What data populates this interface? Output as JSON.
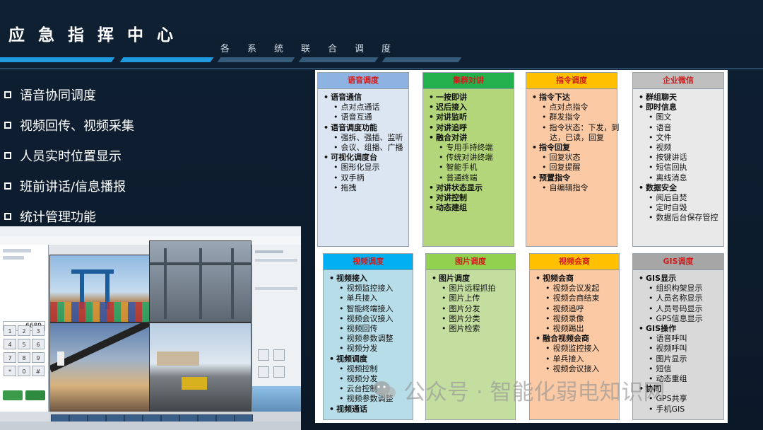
{
  "header": {
    "title": "应急指挥中心",
    "subtitle": "各系统联合调度"
  },
  "colors": {
    "background": "#0f2033",
    "accent_blue": "#1f9be0",
    "accent_dark": "#345b7a",
    "header_text": "#d11b1b"
  },
  "bullets": [
    "语音协同调度",
    "视频回传、视频采集",
    "人员实时位置显示",
    "班前讲话/信息播报",
    "统计管理功能"
  ],
  "screenshot": {
    "dial_value": "6689",
    "keys": [
      "1",
      "2",
      "3",
      "4",
      "5",
      "6",
      "7",
      "8",
      "9",
      "*",
      "0",
      "#"
    ]
  },
  "cards": [
    {
      "title": "语音调度",
      "head_color": "#8db3e2",
      "body_color": "#dce6f2",
      "items": [
        {
          "t": "语音通信",
          "lvl": 1
        },
        {
          "t": "点对点通话",
          "lvl": 2
        },
        {
          "t": "语音互通",
          "lvl": 2
        },
        {
          "t": "语音调度功能",
          "lvl": 1
        },
        {
          "t": "强拆、强插、监听",
          "lvl": 2
        },
        {
          "t": "会议、组播、广播",
          "lvl": 2
        },
        {
          "t": "可视化调度台",
          "lvl": 1
        },
        {
          "t": "图形化显示",
          "lvl": 2
        },
        {
          "t": "双手柄",
          "lvl": 2
        },
        {
          "t": "拖拽",
          "lvl": 2
        }
      ]
    },
    {
      "title": "集群对讲",
      "head_color": "#22b14c",
      "body_color": "#b4d67a",
      "items": [
        {
          "t": "一按即讲",
          "lvl": 1
        },
        {
          "t": "迟后接入",
          "lvl": 1
        },
        {
          "t": "对讲监听",
          "lvl": 1
        },
        {
          "t": "对讲追呼",
          "lvl": 1
        },
        {
          "t": "融合对讲",
          "lvl": 1
        },
        {
          "t": "专用手持终端",
          "lvl": 2
        },
        {
          "t": "传统对讲终端",
          "lvl": 2
        },
        {
          "t": "智能手机",
          "lvl": 2
        },
        {
          "t": "普通终端",
          "lvl": 2
        },
        {
          "t": "对讲状态显示",
          "lvl": 1
        },
        {
          "t": "对讲控制",
          "lvl": 1
        },
        {
          "t": "动态建组",
          "lvl": 1
        }
      ]
    },
    {
      "title": "指令调度",
      "head_color": "#ffc000",
      "body_color": "#fbc9a4",
      "items": [
        {
          "t": "指令下达",
          "lvl": 1
        },
        {
          "t": "点对点指令",
          "lvl": 2
        },
        {
          "t": "群发指令",
          "lvl": 2
        },
        {
          "t": "指令状态：下发，到",
          "lvl": 2
        },
        {
          "t": "达，已读，回复",
          "lvl": 3
        },
        {
          "t": "指令回复",
          "lvl": 1
        },
        {
          "t": "回复状态",
          "lvl": 2
        },
        {
          "t": "回复提醒",
          "lvl": 2
        },
        {
          "t": "预置指令",
          "lvl": 1
        },
        {
          "t": "自编辑指令",
          "lvl": 2
        }
      ]
    },
    {
      "title": "企业微信",
      "head_color": "#bfbfbf",
      "body_color": "#e9e9e9",
      "items": [
        {
          "t": "群组聊天",
          "lvl": 1
        },
        {
          "t": "即时信息",
          "lvl": 1
        },
        {
          "t": "图文",
          "lvl": 2
        },
        {
          "t": "语音",
          "lvl": 2
        },
        {
          "t": "文件",
          "lvl": 2
        },
        {
          "t": "视频",
          "lvl": 2
        },
        {
          "t": "按键讲话",
          "lvl": 2
        },
        {
          "t": "短信回执",
          "lvl": 2
        },
        {
          "t": "离线消息",
          "lvl": 2
        },
        {
          "t": "数据安全",
          "lvl": 1
        },
        {
          "t": "阅后自焚",
          "lvl": 2
        },
        {
          "t": "定时自毁",
          "lvl": 2
        },
        {
          "t": "数据后台保存管控",
          "lvl": 2
        }
      ]
    },
    {
      "title": "视频调度",
      "head_color": "#00b0f0",
      "body_color": "#b7dde8",
      "items": [
        {
          "t": "视频接入",
          "lvl": 1
        },
        {
          "t": "视频监控接入",
          "lvl": 2
        },
        {
          "t": "单兵接入",
          "lvl": 2
        },
        {
          "t": "智能终端接入",
          "lvl": 2
        },
        {
          "t": "视频会议接入",
          "lvl": 2
        },
        {
          "t": "视频回传",
          "lvl": 2
        },
        {
          "t": "视频参数调整",
          "lvl": 2
        },
        {
          "t": "视频分发",
          "lvl": 2
        },
        {
          "t": "视频调度",
          "lvl": 1
        },
        {
          "t": "视频控制",
          "lvl": 2
        },
        {
          "t": "视频分发",
          "lvl": 2
        },
        {
          "t": "云台控制",
          "lvl": 2
        },
        {
          "t": "视频参数调整",
          "lvl": 2
        },
        {
          "t": "视频通话",
          "lvl": 1
        }
      ]
    },
    {
      "title": "图片调度",
      "head_color": "#92d050",
      "body_color": "#c4dea0",
      "items": [
        {
          "t": "图片调度",
          "lvl": 1
        },
        {
          "t": "图片远程抓拍",
          "lvl": 2
        },
        {
          "t": "图片上传",
          "lvl": 2
        },
        {
          "t": "图片分发",
          "lvl": 2
        },
        {
          "t": "图片分类",
          "lvl": 2
        },
        {
          "t": "图片检索",
          "lvl": 2
        }
      ]
    },
    {
      "title": "视频会商",
      "head_color": "#ffc000",
      "body_color": "#fbc9a4",
      "items": [
        {
          "t": "视频会商",
          "lvl": 1
        },
        {
          "t": "视频会议发起",
          "lvl": 2
        },
        {
          "t": "视频会商结束",
          "lvl": 2
        },
        {
          "t": "视频追呼",
          "lvl": 2
        },
        {
          "t": "视频录像",
          "lvl": 2
        },
        {
          "t": "视频踢出",
          "lvl": 2
        },
        {
          "t": "融合视频会商",
          "lvl": 1
        },
        {
          "t": "视频监控接入",
          "lvl": 2
        },
        {
          "t": "单兵接入",
          "lvl": 2
        },
        {
          "t": "视频会议接入",
          "lvl": 2
        }
      ]
    },
    {
      "title": "GIS调度",
      "head_color": "#a6a6a6",
      "body_color": "#d9d9d9",
      "items": [
        {
          "t": "GIS显示",
          "lvl": 1
        },
        {
          "t": "组织构架显示",
          "lvl": 2
        },
        {
          "t": "人员名称显示",
          "lvl": 2
        },
        {
          "t": "人员号码显示",
          "lvl": 2
        },
        {
          "t": "GPS信息显示",
          "lvl": 2
        },
        {
          "t": "GIS操作",
          "lvl": 1
        },
        {
          "t": "语音呼叫",
          "lvl": 2
        },
        {
          "t": "视频呼叫",
          "lvl": 2
        },
        {
          "t": "图片显示",
          "lvl": 2
        },
        {
          "t": "短信",
          "lvl": 2
        },
        {
          "t": "动态重组",
          "lvl": 2
        },
        {
          "t": "协同",
          "lvl": 1
        },
        {
          "t": "GPS共享",
          "lvl": 2
        },
        {
          "t": "手机GIS",
          "lvl": 2
        }
      ]
    }
  ],
  "watermark": "公众号 · 智能化弱电知识网"
}
